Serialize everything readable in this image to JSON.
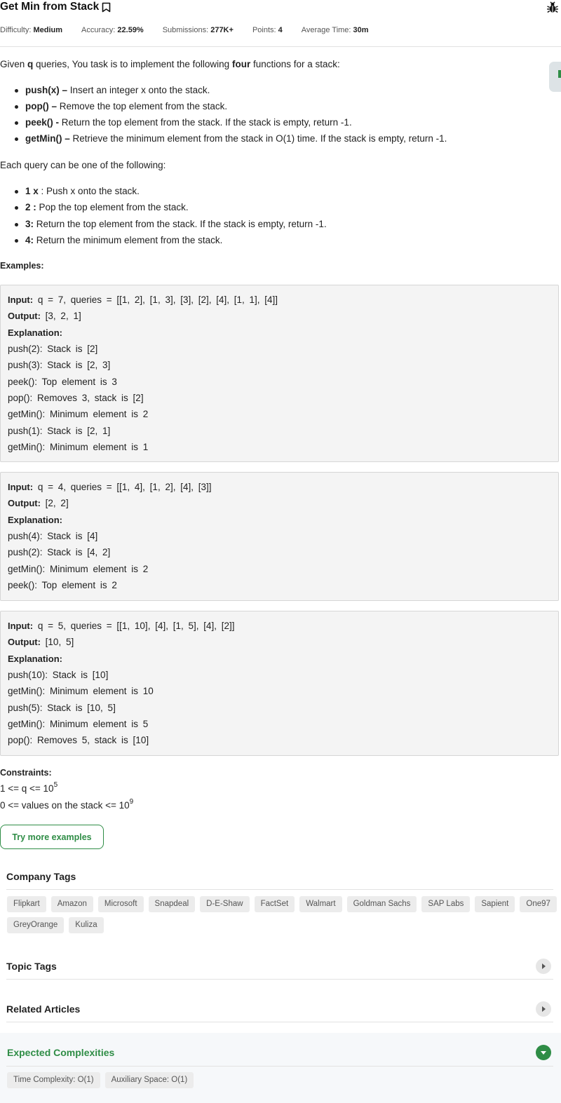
{
  "header": {
    "title": "Get Min from Stack",
    "meta": [
      {
        "label": "Difficulty: ",
        "value": "Medium"
      },
      {
        "label": "Accuracy: ",
        "value": "22.59%"
      },
      {
        "label": "Submissions: ",
        "value": "277K+"
      },
      {
        "label": "Points: ",
        "value": "4"
      },
      {
        "label": "Average Time: ",
        "value": "30m"
      }
    ]
  },
  "description": {
    "intro_pre": "Given ",
    "intro_q": "q",
    "intro_mid": " queries, You task is to implement the following ",
    "intro_four": "four",
    "intro_post": " functions for a stack:",
    "functions": [
      {
        "name": "push(x) –",
        "text": " Insert an integer x onto the stack."
      },
      {
        "name": "pop() –",
        "text": " Remove the top element from the stack."
      },
      {
        "name": "peek() -",
        "text": " Return the top element from the stack. If the stack is empty, return -1."
      },
      {
        "name": "getMin() –",
        "text": " Retrieve the minimum element from the stack in O(1) time. If the stack is empty, return -1."
      }
    ],
    "query_intro": "Each query can be one of the following:",
    "queries": [
      {
        "name": "1 x",
        "text": " : Push x onto the stack."
      },
      {
        "name": "2 :",
        "text": " Pop the top element from the stack."
      },
      {
        "name": "3:",
        "text": " Return the top element from the stack. If the stack is empty, return -1."
      },
      {
        "name": "4:",
        "text": " Return the minimum element from the stack."
      }
    ]
  },
  "examples_heading": "Examples:",
  "examples": [
    {
      "input_label": "Input:",
      "input": " q = 7, queries = [[1, 2], [1, 3], [3], [2], [4], [1, 1], [4]]",
      "output_label": "Output:",
      "output": " [3, 2, 1]",
      "explanation_label": "Explanation:",
      "lines": [
        "push(2): Stack is [2]",
        "push(3): Stack is [2, 3]",
        "peek(): Top element is 3",
        "pop(): Removes 3, stack is [2]",
        "getMin(): Minimum element is 2",
        "push(1): Stack is [2, 1]",
        "getMin(): Minimum element is 1"
      ]
    },
    {
      "input_label": "Input:",
      "input": " q = 4, queries = [[1, 4], [1, 2], [4], [3]]",
      "output_label": "Output:",
      "output": " [2, 2]",
      "explanation_label": "Explanation:",
      "lines": [
        "push(4): Stack is [4]",
        "push(2): Stack is [4, 2]",
        "getMin(): Minimum element is 2",
        "peek(): Top element is 2"
      ]
    },
    {
      "input_label": "Input:",
      "input": " q = 5, queries = [[1, 10], [4], [1, 5], [4], [2]]",
      "output_label": "Output:",
      "output": " [10, 5]",
      "explanation_label": "Explanation:",
      "lines": [
        "push(10): Stack is [10]",
        "getMin(): Minimum element is 10",
        "push(5): Stack is [10, 5]",
        "getMin(): Minimum element is 5",
        "pop(): Removes 5, stack is [10]"
      ]
    }
  ],
  "constraints": {
    "heading": "Constraints:",
    "c1": "1 <= q <= 10",
    "c1_exp": "5",
    "c2": "0 <= values on the stack <= 10",
    "c2_exp": "9"
  },
  "try_button": "Try more examples",
  "company_tags": {
    "heading": "Company Tags",
    "tags": [
      "Flipkart",
      "Amazon",
      "Microsoft",
      "Snapdeal",
      "D-E-Shaw",
      "FactSet",
      "Walmart",
      "Goldman Sachs",
      "SAP Labs",
      "Sapient",
      "One97",
      "GreyOrange",
      "Kuliza"
    ]
  },
  "topic_tags": {
    "heading": "Topic Tags"
  },
  "related_articles": {
    "heading": "Related Articles"
  },
  "expected": {
    "heading": "Expected Complexities",
    "tags": [
      "Time Complexity: O(1)",
      "Auxiliary Space: O(1)"
    ]
  },
  "colors": {
    "accent": "#2f8d46",
    "box_bg": "#f4f4f4",
    "tag_bg": "#ececec"
  }
}
